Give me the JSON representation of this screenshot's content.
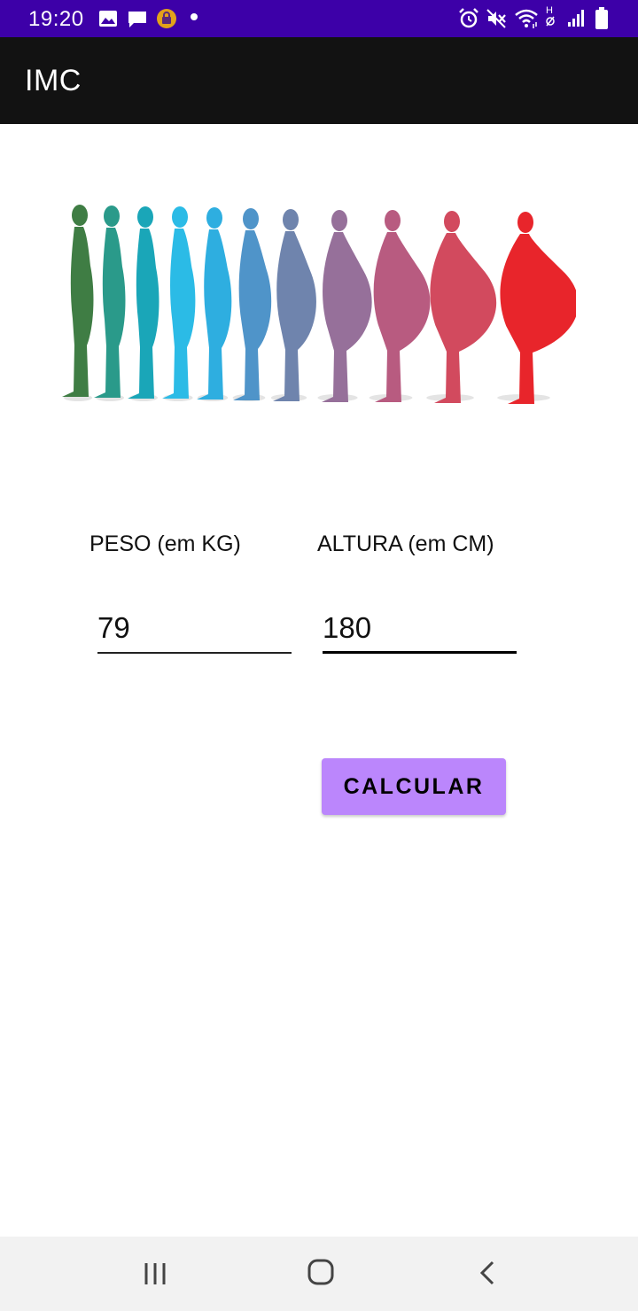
{
  "status_bar": {
    "time": "19:20",
    "background_color": "#3d00a8",
    "left_icons": [
      "gallery-icon",
      "chat-icon",
      "lock-app-icon",
      "dot-icon"
    ],
    "right_icons": [
      "alarm-icon",
      "mute-icon",
      "wifi-icon",
      "h-network-icon",
      "signal-icon",
      "battery-icon"
    ],
    "network_type": "H"
  },
  "app_bar": {
    "title": "IMC",
    "background_color": "#121212"
  },
  "illustration": {
    "name": "body-silhouettes-illustration",
    "figure_colors": [
      "#3f7d44",
      "#2a9a8a",
      "#1aa6b8",
      "#2bbbe6",
      "#2eaee0",
      "#4f94c9",
      "#6f84ad",
      "#96709a",
      "#b85b80",
      "#d24a5e",
      "#e8252b"
    ]
  },
  "form": {
    "peso_label": "PESO (em KG)",
    "peso_value": "79",
    "altura_label": "ALTURA (em CM)",
    "altura_value": "180"
  },
  "button": {
    "label": "CALCULAR",
    "color": "#bb86fc"
  },
  "nav_bar": {
    "icons": [
      "recents-icon",
      "home-icon",
      "back-icon"
    ]
  }
}
